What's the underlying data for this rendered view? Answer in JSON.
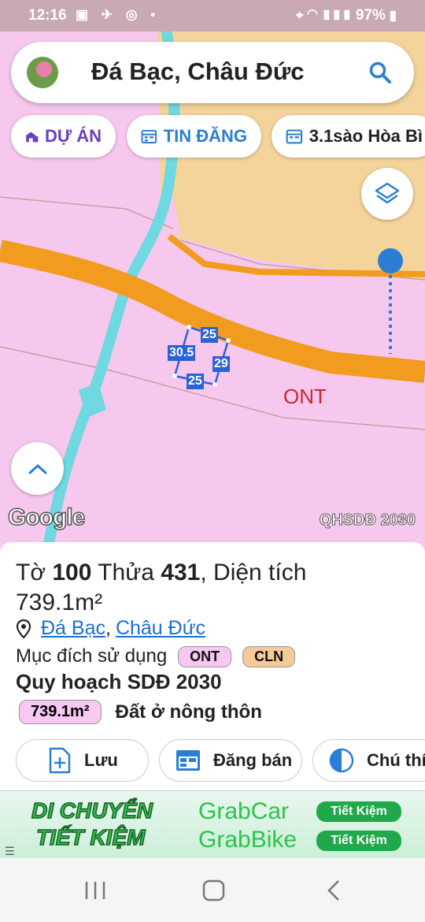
{
  "status_bar": {
    "time": "12:16",
    "left_icons": [
      "gallery-icon",
      "send-icon",
      "compass-icon",
      "dot-icon"
    ],
    "right_icons": [
      "location-icon",
      "wifi-icon",
      "mute-icon",
      "signal-icon"
    ],
    "battery": "97%"
  },
  "search": {
    "title": "Đá Bạc, Châu Đức"
  },
  "chips": {
    "project": "DỰ ÁN",
    "listing": "TIN ĐĂNG",
    "property": "3.1sào Hòa Bì"
  },
  "map": {
    "zone_label": "ONT",
    "plot_edges": [
      "25",
      "30.5",
      "29",
      "25"
    ],
    "google_logo": "Google",
    "layer_label": "QHSDĐ 2030",
    "colors": {
      "land": "#f6c8ee",
      "road": "#f29c1f",
      "river": "#6fd8e0",
      "agri": "#f5d49b"
    }
  },
  "panel": {
    "title_prefix": "Tờ ",
    "sheet": "100",
    "title_mid": " Thửa ",
    "parcel": "431",
    "title_suffix": ", Diện tích",
    "area": "739.1m²",
    "location_commune": "Đá Bạc",
    "location_sep": ",",
    "location_district": "Châu Đức",
    "usage_label": "Mục đích sử dụng",
    "usage_badges": [
      "ONT",
      "CLN"
    ],
    "plan_title": "Quy hoạch SDĐ 2030",
    "plan_area": "739.1m²",
    "plan_desc": "Đất ở nông thôn"
  },
  "actions": {
    "save": "Lưu",
    "sell": "Đăng bán",
    "note": "Chú thí"
  },
  "banner": {
    "left_line1": "DI CHUYỂN",
    "left_line2": "TIẾT KIỆM",
    "grabcar": "GrabCar",
    "grabbike": "GrabBike",
    "pill": "Tiết Kiệm"
  }
}
